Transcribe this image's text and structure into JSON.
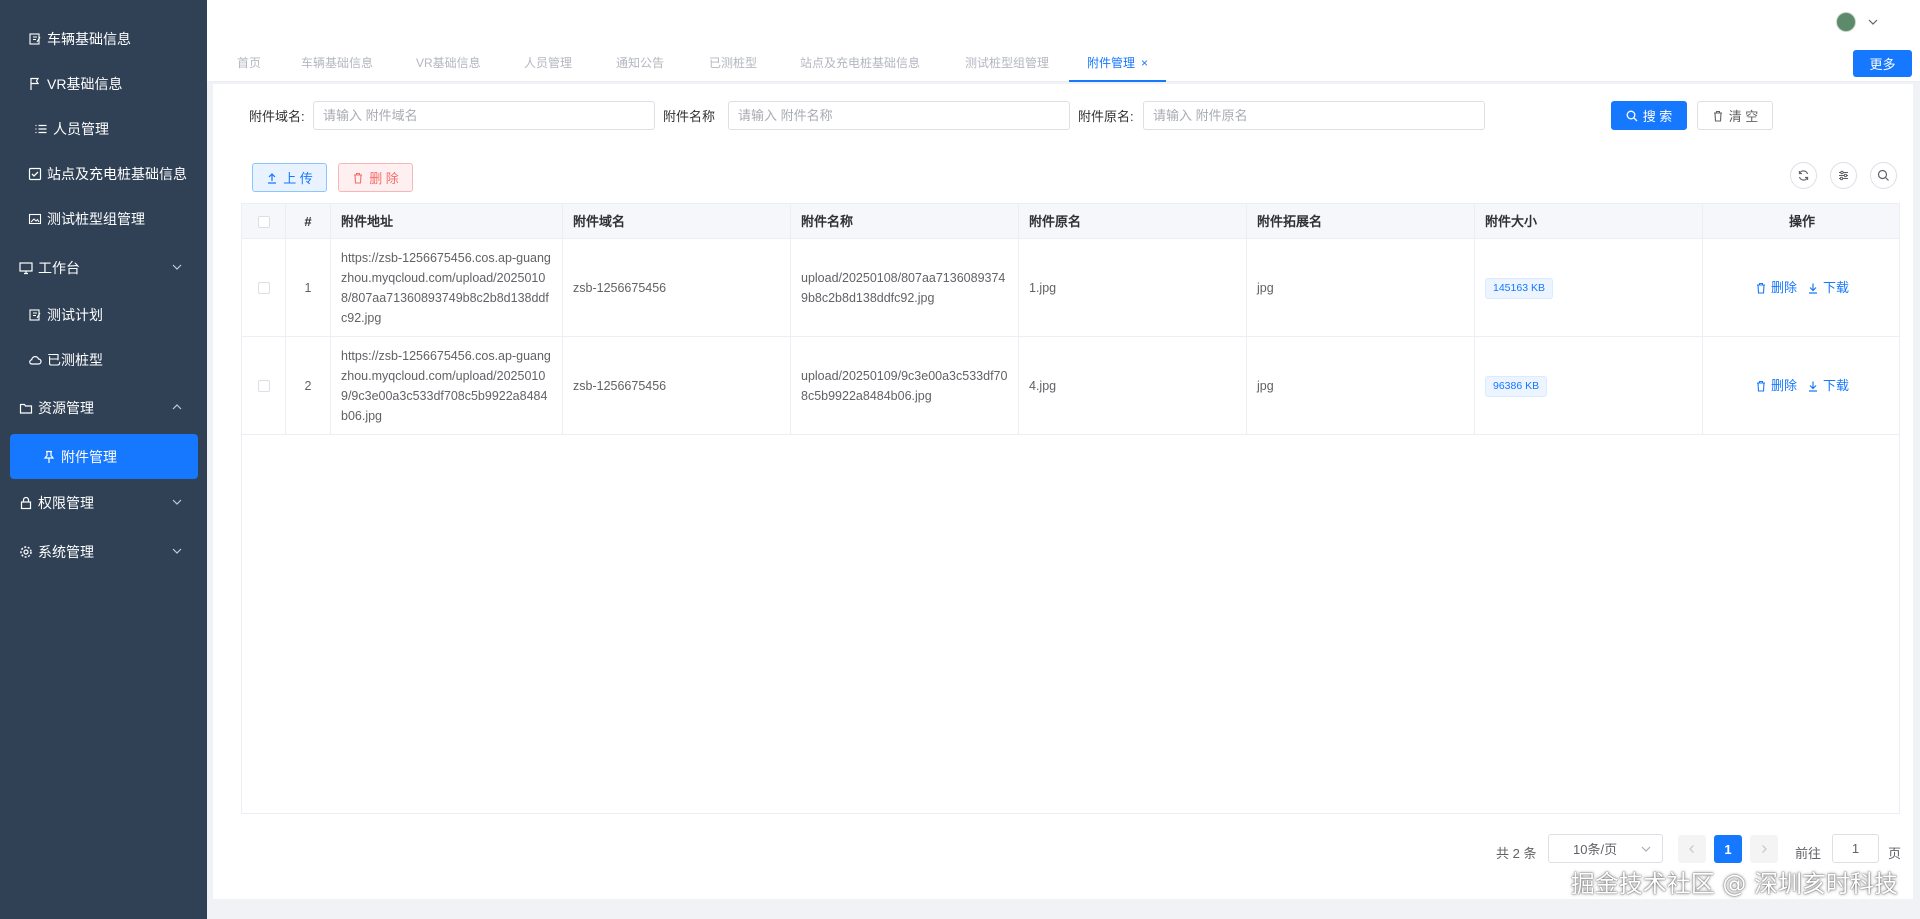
{
  "colors": {
    "sidebar_bg": "#304156",
    "accent": "#1677ff",
    "danger": "#f56c6c"
  },
  "sidebar": {
    "items": [
      {
        "label": "车辆基础信息",
        "icon": "edit-icon"
      },
      {
        "label": "VR基础信息",
        "icon": "flag-icon"
      },
      {
        "label": "人员管理",
        "icon": "list-icon"
      },
      {
        "label": "站点及充电桩基础信息",
        "icon": "checkbox-icon"
      },
      {
        "label": "测试桩型组管理",
        "icon": "image-icon"
      },
      {
        "label": "工作台",
        "icon": "monitor-icon",
        "expandable": true
      },
      {
        "label": "测试计划",
        "icon": "edit-icon"
      },
      {
        "label": "已测桩型",
        "icon": "cloud-icon"
      },
      {
        "label": "资源管理",
        "icon": "folder-icon",
        "expandable": true
      },
      {
        "label": "附件管理",
        "icon": "pin-icon",
        "active": true
      },
      {
        "label": "权限管理",
        "icon": "lock-icon",
        "expandable": true
      },
      {
        "label": "系统管理",
        "icon": "gear-icon",
        "expandable": true
      }
    ]
  },
  "tabs": {
    "items": [
      "首页",
      "车辆基础信息",
      "VR基础信息",
      "人员管理",
      "通知公告",
      "已测桩型",
      "站点及充电桩基础信息",
      "测试桩型组管理",
      "附件管理"
    ],
    "active_index": 8,
    "close_glyph": "×",
    "more_label": "更多"
  },
  "search": {
    "domain_label": "附件域名:",
    "domain_placeholder": "请输入 附件域名",
    "name_label": "附件名称",
    "name_placeholder": "请输入 附件名称",
    "orig_label": "附件原名:",
    "orig_placeholder": "请输入 附件原名",
    "search_label": "搜 索",
    "clear_label": "清 空"
  },
  "toolbar": {
    "upload_label": "上 传",
    "delete_label": "删 除"
  },
  "table": {
    "columns": [
      "#",
      "附件地址",
      "附件域名",
      "附件名称",
      "附件原名",
      "附件拓展名",
      "附件大小",
      "操作"
    ],
    "rows": [
      {
        "index": "1",
        "url": "https://zsb-1256675456.cos.ap-guangzhou.myqcloud.com/upload/20250108/807aa71360893749b8c2b8d138ddfc92.jpg",
        "domain": "zsb-1256675456",
        "name": "upload/20250108/807aa71360893749b8c2b8d138ddfc92.jpg",
        "original": "1.jpg",
        "ext": "jpg",
        "size": "145163 KB"
      },
      {
        "index": "2",
        "url": "https://zsb-1256675456.cos.ap-guangzhou.myqcloud.com/upload/20250109/9c3e00a3c533df708c5b9922a8484b06.jpg",
        "domain": "zsb-1256675456",
        "name": "upload/20250109/9c3e00a3c533df708c5b9922a8484b06.jpg",
        "original": "4.jpg",
        "ext": "jpg",
        "size": "96386 KB"
      }
    ],
    "row_delete_label": "删除",
    "row_download_label": "下载"
  },
  "pagination": {
    "total": "共 2 条",
    "page_size": "10条/页",
    "current_page": "1",
    "goto_label": "前往",
    "goto_value": "1",
    "page_suffix": "页"
  },
  "watermark": "掘金技术社区 @ 深圳亥时科技"
}
